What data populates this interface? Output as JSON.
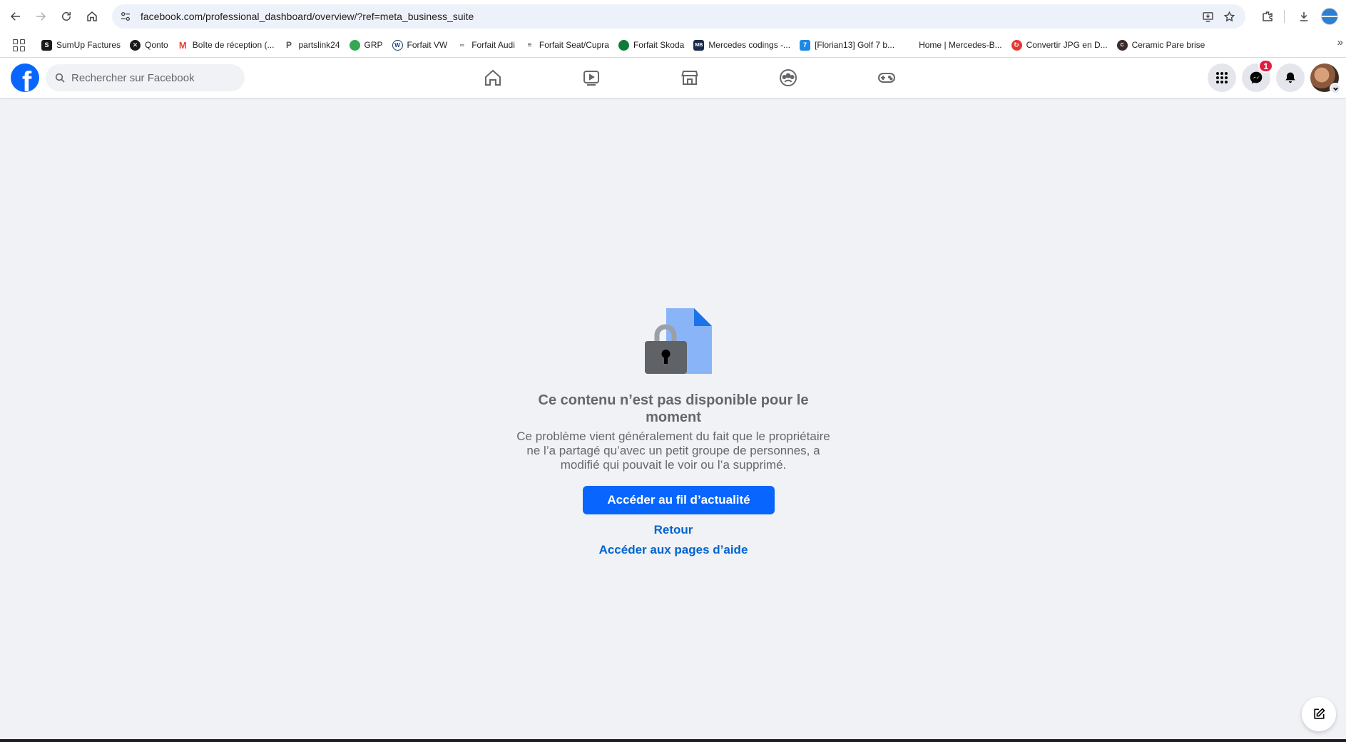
{
  "browser": {
    "url": "facebook.com/professional_dashboard/overview/?ref=meta_business_suite",
    "bookmarks": [
      {
        "label": "SumUp Factures",
        "icon": "sumup-icon",
        "color": "#1a1a1a"
      },
      {
        "label": "Qonto",
        "icon": "qonto-icon",
        "color": "#1a1a1a"
      },
      {
        "label": "Boîte de réception (...",
        "icon": "gmail-icon",
        "color": "#ea4335"
      },
      {
        "label": "partslink24",
        "icon": "partslink-icon",
        "color": "#f5b400"
      },
      {
        "label": "GRP",
        "icon": "grp-icon",
        "color": "#34a853"
      },
      {
        "label": "Forfait VW",
        "icon": "vw-icon",
        "color": "#1b3a6b"
      },
      {
        "label": "Forfait Audi",
        "icon": "audi-icon",
        "color": "#777777"
      },
      {
        "label": "Forfait Seat/Cupra",
        "icon": "seat-icon",
        "color": "#555555"
      },
      {
        "label": "Forfait Skoda",
        "icon": "skoda-icon",
        "color": "#0e7a3a"
      },
      {
        "label": "Mercedes codings -...",
        "icon": "mb-icon",
        "color": "#1b2a4a"
      },
      {
        "label": "[Florian13] Golf 7 b...",
        "icon": "seven-icon",
        "color": "#1e88e5"
      },
      {
        "label": "Home | Mercedes-B...",
        "icon": "blank-icon",
        "color": "#ffffff"
      },
      {
        "label": "Convertir JPG en D...",
        "icon": "convert-icon",
        "color": "#e53935"
      },
      {
        "label": "Ceramic Pare brise",
        "icon": "ceramic-icon",
        "color": "#3a2a2a"
      }
    ]
  },
  "facebook": {
    "search_placeholder": "Rechercher sur Facebook",
    "messenger_badge": "1",
    "colors": {
      "brand": "#0866ff",
      "link": "#0064d1",
      "badge": "#e41e3f"
    }
  },
  "main": {
    "title": "Ce contenu n’est pas disponible pour le moment",
    "body": "Ce problème vient généralement du fait que le propriétaire ne l’a partagé qu’avec un petit groupe de personnes, a modifié qui pouvait le voir ou l’a supprimé.",
    "primary_button": "Accéder au fil d’actualité",
    "back_link": "Retour",
    "help_link": "Accéder aux pages d’aide"
  }
}
